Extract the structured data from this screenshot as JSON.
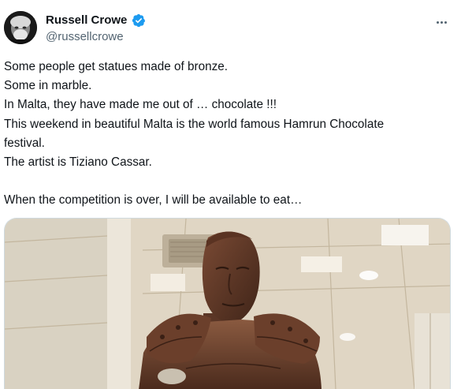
{
  "author": {
    "display_name": "Russell Crowe",
    "handle": "@russellcrowe",
    "verified": true,
    "verified_color": "#1d9bf0"
  },
  "icons": {
    "avatar": "avatar-photo",
    "verified": "verified-badge-icon",
    "more": "more-options-icon"
  },
  "tweet": {
    "lines": [
      "Some people get statues made of bronze.",
      "Some in marble.",
      "In Malta, they have made me out of … chocolate !!!",
      "This weekend in beautiful Malta is the world famous Hamrun Chocolate",
      "festival.",
      "The artist is Tiziano Cassar.",
      "",
      "When the competition is over, I will be available to eat…"
    ]
  },
  "colors": {
    "text": "#0f1419",
    "secondary": "#536471",
    "border": "#cfd9de"
  }
}
